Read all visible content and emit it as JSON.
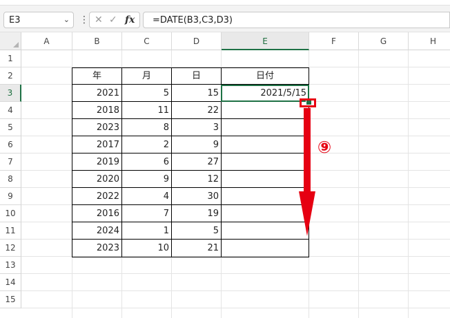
{
  "formula_bar": {
    "name_box": "E3",
    "name_box_chevron": "⌄",
    "separator": "⋮",
    "cancel_glyph": "✕",
    "enter_glyph": "✓",
    "fx_label": "fx",
    "formula": "=DATE(B3,C3,D3)"
  },
  "sheet": {
    "columns": [
      "A",
      "B",
      "C",
      "D",
      "E",
      "F",
      "G",
      "H"
    ],
    "selected_column": "E",
    "rows": [
      "1",
      "2",
      "3",
      "4",
      "5",
      "6",
      "7",
      "8",
      "9",
      "10",
      "11",
      "12",
      "13",
      "14",
      "15"
    ],
    "selected_row": "3",
    "active_cell": "E3"
  },
  "table": {
    "headers": [
      "年",
      "月",
      "日",
      "日付"
    ],
    "rows": [
      {
        "year": "2021",
        "month": "5",
        "day": "15",
        "date": "2021/5/15"
      },
      {
        "year": "2018",
        "month": "11",
        "day": "22",
        "date": ""
      },
      {
        "year": "2023",
        "month": "8",
        "day": "3",
        "date": ""
      },
      {
        "year": "2017",
        "month": "2",
        "day": "9",
        "date": ""
      },
      {
        "year": "2019",
        "month": "6",
        "day": "27",
        "date": ""
      },
      {
        "year": "2020",
        "month": "9",
        "day": "12",
        "date": ""
      },
      {
        "year": "2022",
        "month": "4",
        "day": "30",
        "date": ""
      },
      {
        "year": "2016",
        "month": "7",
        "day": "19",
        "date": ""
      },
      {
        "year": "2024",
        "month": "1",
        "day": "5",
        "date": ""
      },
      {
        "year": "2023",
        "month": "10",
        "day": "21",
        "date": ""
      }
    ]
  },
  "annotation": {
    "step_number": "⑨",
    "color": "#e60012"
  },
  "colors": {
    "selection_green": "#1e7145",
    "annotation_red": "#e60012"
  }
}
